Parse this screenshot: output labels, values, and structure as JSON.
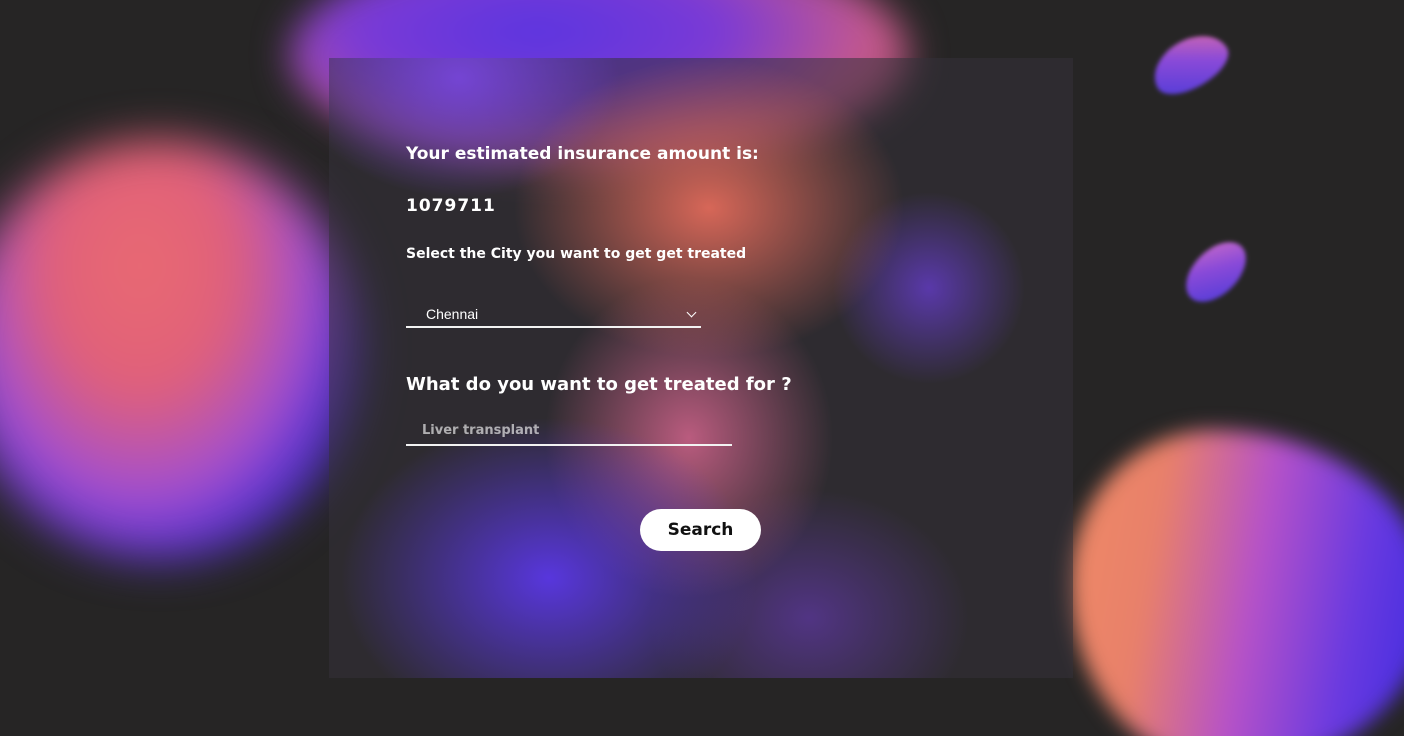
{
  "result": {
    "label": "Your estimated insurance amount is:",
    "amount": "1079711"
  },
  "city": {
    "label": "Select the City you want to get get treated",
    "selected": "Chennai"
  },
  "treatment": {
    "label": "What do you want to get treated for ?",
    "placeholder": "Liver transplant",
    "value": ""
  },
  "actions": {
    "search_label": "Search"
  },
  "colors": {
    "background": "#262525",
    "button_bg": "#ffffff",
    "button_text": "#111111",
    "text": "#ffffff"
  }
}
